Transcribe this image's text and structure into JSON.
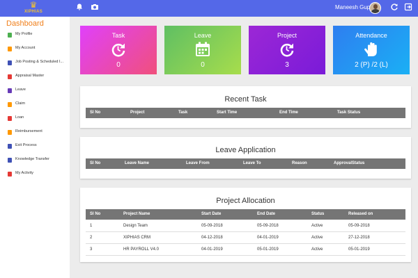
{
  "header": {
    "logo_text": "XIPHIAS",
    "user_name": "Maneesh Gupta",
    "icons": [
      "bell-icon",
      "camera-icon",
      "refresh-icon",
      "logout-icon"
    ]
  },
  "sidebar": {
    "title": "Dashboard",
    "items": [
      {
        "label": "My Profile",
        "icon": "profile-icon",
        "color": "#4caf50"
      },
      {
        "label": "My Account",
        "icon": "account-icon",
        "color": "#ff9800"
      },
      {
        "label": "Job Posting & Scheduled I...",
        "icon": "job-icon",
        "color": "#3f51b5"
      },
      {
        "label": "Appraisal Master",
        "icon": "eye-icon",
        "color": "#e53935"
      },
      {
        "label": "Leave",
        "icon": "leave-icon",
        "color": "#673ab7"
      },
      {
        "label": "Claim",
        "icon": "claim-icon",
        "color": "#ff9800"
      },
      {
        "label": "Loan",
        "icon": "loan-icon",
        "color": "#e53935"
      },
      {
        "label": "Reimbursement",
        "icon": "reimbursement-icon",
        "color": "#ff9800"
      },
      {
        "label": "Exit Process",
        "icon": "exit-icon",
        "color": "#3f51b5"
      },
      {
        "label": "Knowledge Transfer",
        "icon": "knowledge-icon",
        "color": "#3f51b5"
      },
      {
        "label": "My Activity",
        "icon": "activity-icon",
        "color": "#e53935"
      }
    ]
  },
  "tiles": [
    {
      "title": "Task",
      "value": "0",
      "icon": "refresh-clock-icon",
      "color_from": "#e040fb",
      "color_to": "#f0507c"
    },
    {
      "title": "Leave",
      "value": "0",
      "icon": "calendar-icon",
      "color_from": "#5fbf63",
      "color_to": "#a7dd4c"
    },
    {
      "title": "Project",
      "value": "3",
      "icon": "refresh-clock-icon",
      "color_from": "#9c27d6",
      "color_to": "#7a1bd8"
    },
    {
      "title": "Attendance",
      "value": "2 (P) /2 (L)",
      "icon": "hand-icon",
      "color_from": "#2e7ef0",
      "color_to": "#1ab0f5"
    }
  ],
  "recent_task": {
    "title": "Recent Task",
    "columns": [
      "Sl No",
      "Project",
      "Task",
      "Start Time",
      "End Time",
      "Task Status"
    ]
  },
  "leave_application": {
    "title": "Leave Application",
    "columns": [
      "Sl No",
      "Leave Name",
      "Leave From",
      "Leave To",
      "Reason",
      "ApprovalStatus"
    ]
  },
  "project_allocation": {
    "title": "Project Allocation",
    "columns": [
      "Sl No",
      "Project Name",
      "Start Date",
      "End Date",
      "Status",
      "Released on"
    ],
    "rows": [
      [
        "1",
        "Design Team",
        "05-09-2018",
        "05-09-2018",
        "Active",
        "05-09-2018"
      ],
      [
        "2",
        "XIPHIAS CRM",
        "04-12-2018",
        "04-01-2019",
        "Active",
        "27-12-2018"
      ],
      [
        "3",
        "HR PAYROLL V4.0",
        "04-01-2019",
        "05-01-2019",
        "Active",
        "05-01-2019"
      ]
    ]
  }
}
